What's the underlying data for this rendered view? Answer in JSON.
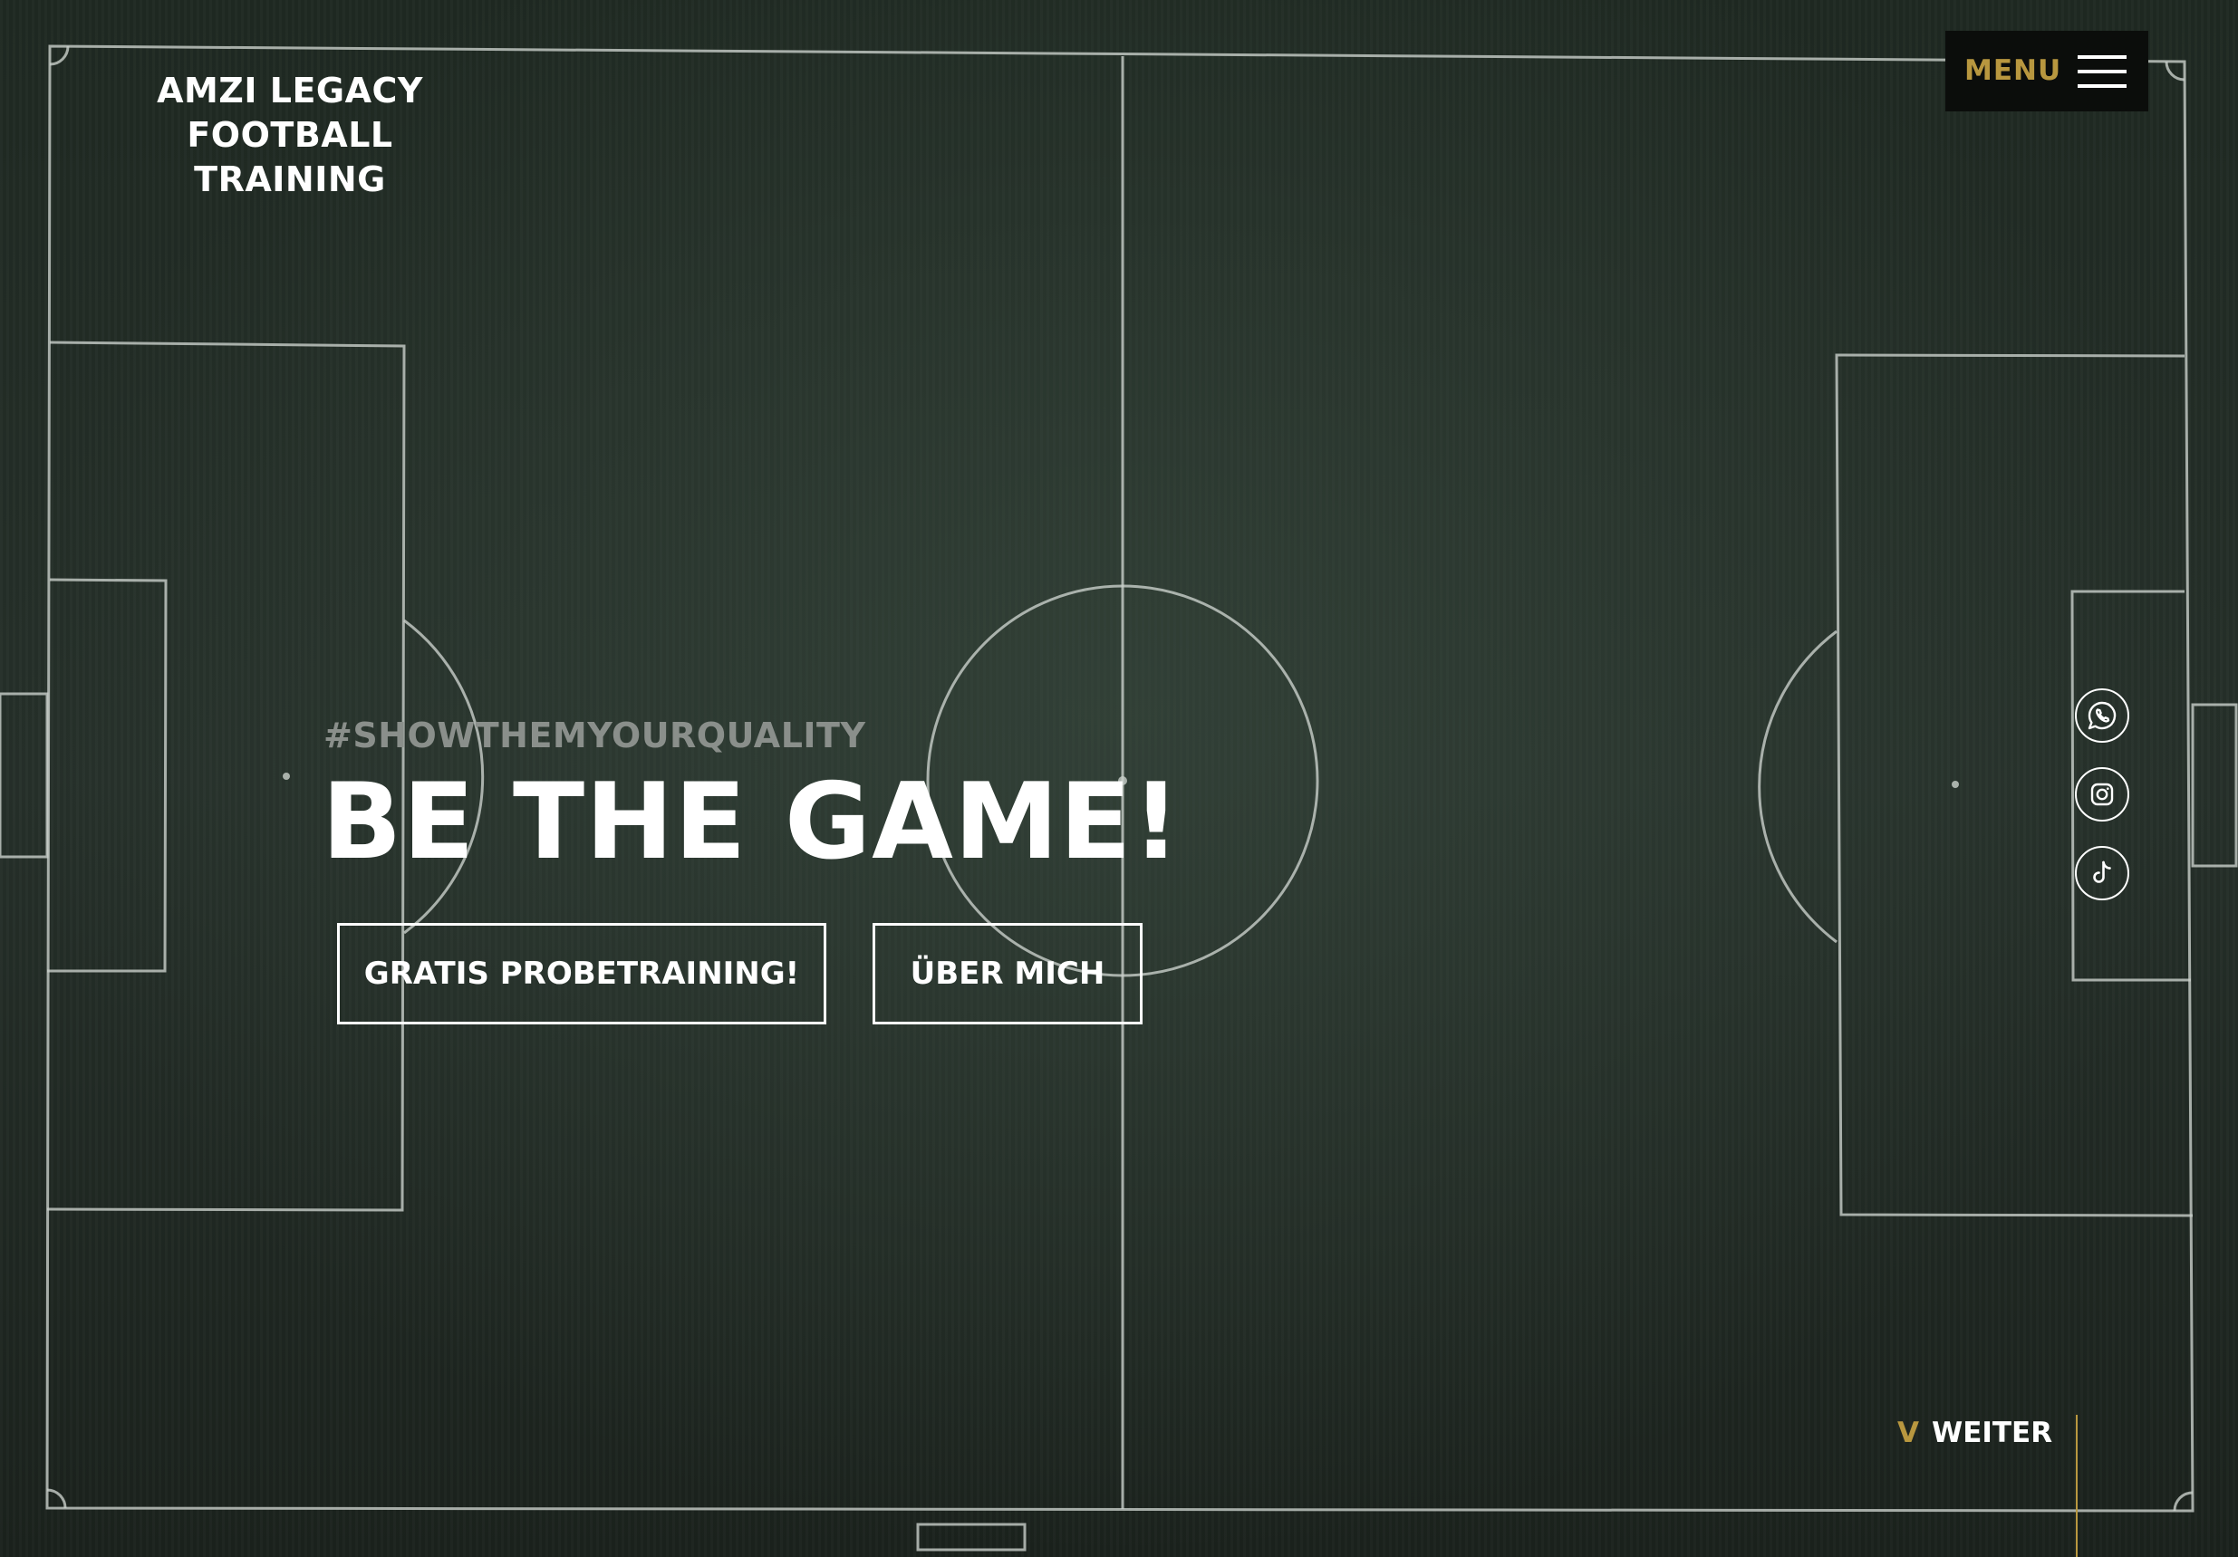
{
  "brand": {
    "line1": "AMZI LEGACY",
    "line2": "FOOTBALL TRAINING"
  },
  "menu": {
    "label": "MENU",
    "icon": "hamburger-icon"
  },
  "hero": {
    "hashtag": "#SHOWTHEMYOURQUALITY",
    "headline": "BE THE GAME!",
    "primary_button": "GRATIS PROBETRAINING!",
    "secondary_button": "ÜBER MICH",
    "background": "football-pitch-aerial"
  },
  "social": [
    {
      "name": "whatsapp",
      "icon": "whatsapp-icon"
    },
    {
      "name": "instagram",
      "icon": "instagram-icon"
    },
    {
      "name": "tiktok",
      "icon": "tiktok-icon"
    }
  ],
  "scroll": {
    "arrow": "V",
    "label": "WEITER"
  },
  "colors": {
    "accent": "#b8973f",
    "text": "#ffffff",
    "hashtag": "#8a8f8b",
    "menu_bg": "#0b0d0b",
    "pitch": "#232c26"
  }
}
